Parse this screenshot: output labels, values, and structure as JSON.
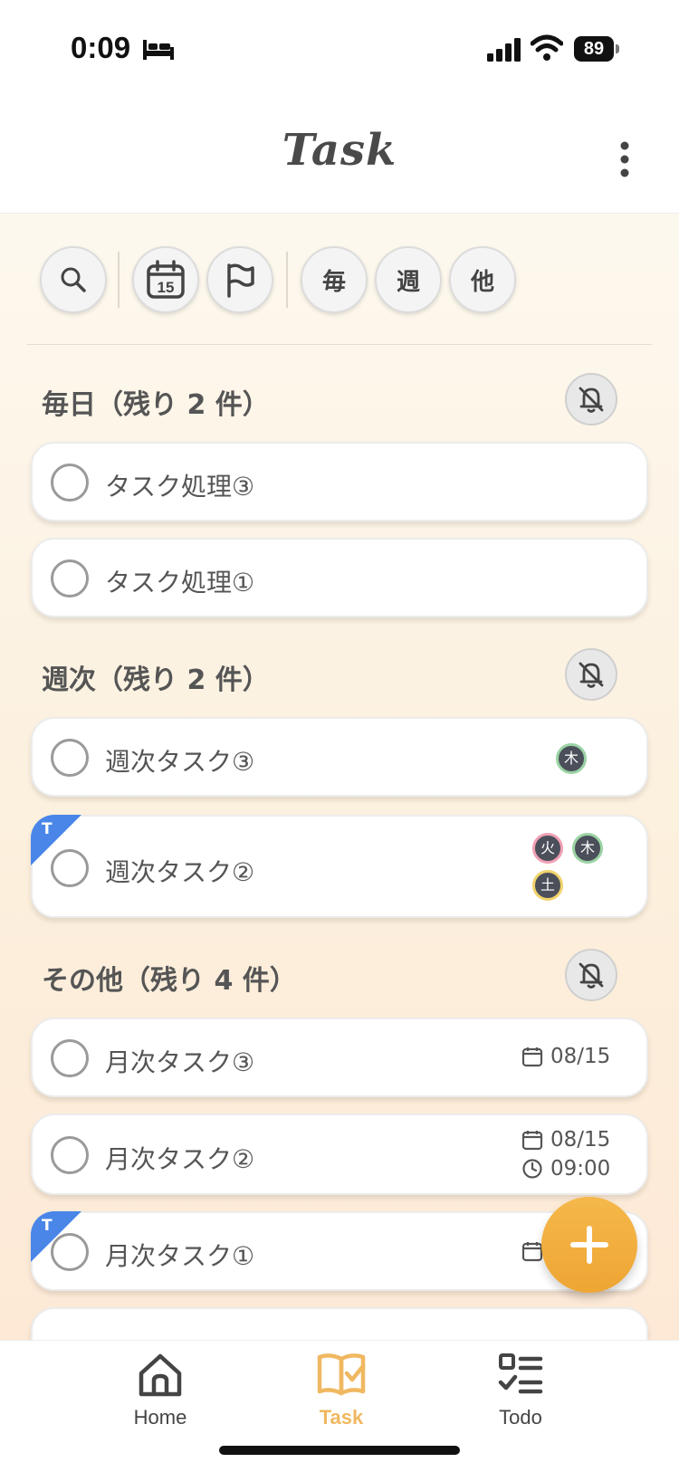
{
  "status_bar": {
    "time": "0:09",
    "battery": "89"
  },
  "header": {
    "title": "Task"
  },
  "filters": {
    "every_day": "毎",
    "weekly": "週",
    "other": "他",
    "calendar_day": "15"
  },
  "sections": [
    {
      "title": "毎日（残り 2 件）",
      "tasks": [
        {
          "label": "タスク処理③"
        },
        {
          "label": "タスク処理①"
        }
      ]
    },
    {
      "title": "週次（残り 2 件）",
      "tasks": [
        {
          "label": "週次タスク③",
          "days": [
            "木"
          ]
        },
        {
          "label": "週次タスク②",
          "tag": "T",
          "days": [
            "火",
            "木",
            "土"
          ]
        }
      ]
    },
    {
      "title": "その他（残り 4 件）",
      "tasks": [
        {
          "label": "月次タスク③",
          "date": "08/15"
        },
        {
          "label": "月次タスク②",
          "date": "08/15",
          "time": "09:00"
        },
        {
          "label": "月次タスク①",
          "tag": "T"
        }
      ]
    }
  ],
  "nav": {
    "home": "Home",
    "task": "Task",
    "todo": "Todo",
    "active": "Task"
  },
  "colors": {
    "accent": "#F0A93A",
    "tag_blue": "#4A86E8",
    "badge_bg": "#4A4F5A"
  }
}
